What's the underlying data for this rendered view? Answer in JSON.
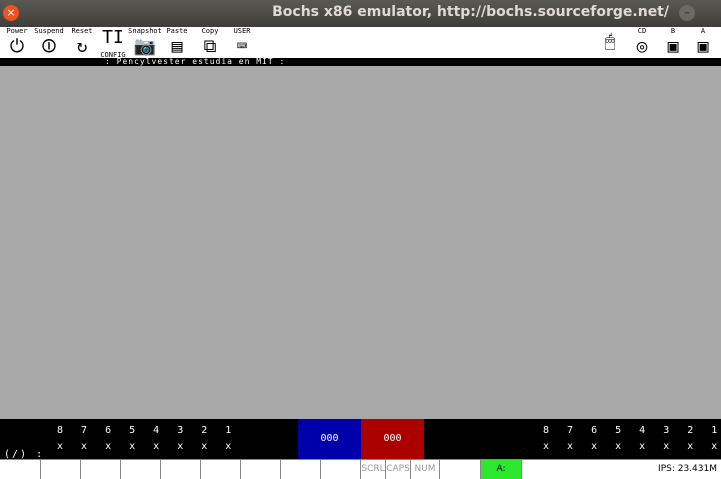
{
  "window": {
    "title": "Bochs x86 emulator, http://bochs.sourceforge.net/",
    "close_symbol": "×",
    "min_symbol": "–"
  },
  "toolbar": {
    "power": "Power",
    "suspend": "Suspend",
    "reset": "Reset",
    "config": "CONFIG",
    "snapshot": "Snapshot",
    "paste": "Paste",
    "copy": "Copy",
    "user": "USER",
    "cd": "CD",
    "floppy_b": "B",
    "floppy_a": "A"
  },
  "marquee": ": Pencylvester estudia en MIT :",
  "panel": {
    "left_numbers": "8 7 6 5 4 3 2 1",
    "left_marks": "x x x x x x x x",
    "left_extra": "(/)  :",
    "right_numbers": "8 7 6 5 4 3 2 1",
    "right_marks": "x x x x x x x x",
    "blue_value": "000",
    "red_value": "000"
  },
  "statusbar": {
    "ips": "IPS: 23.431M",
    "a": "A:",
    "num": "NUM",
    "caps": "CAPS",
    "scrl": "SCRL"
  }
}
